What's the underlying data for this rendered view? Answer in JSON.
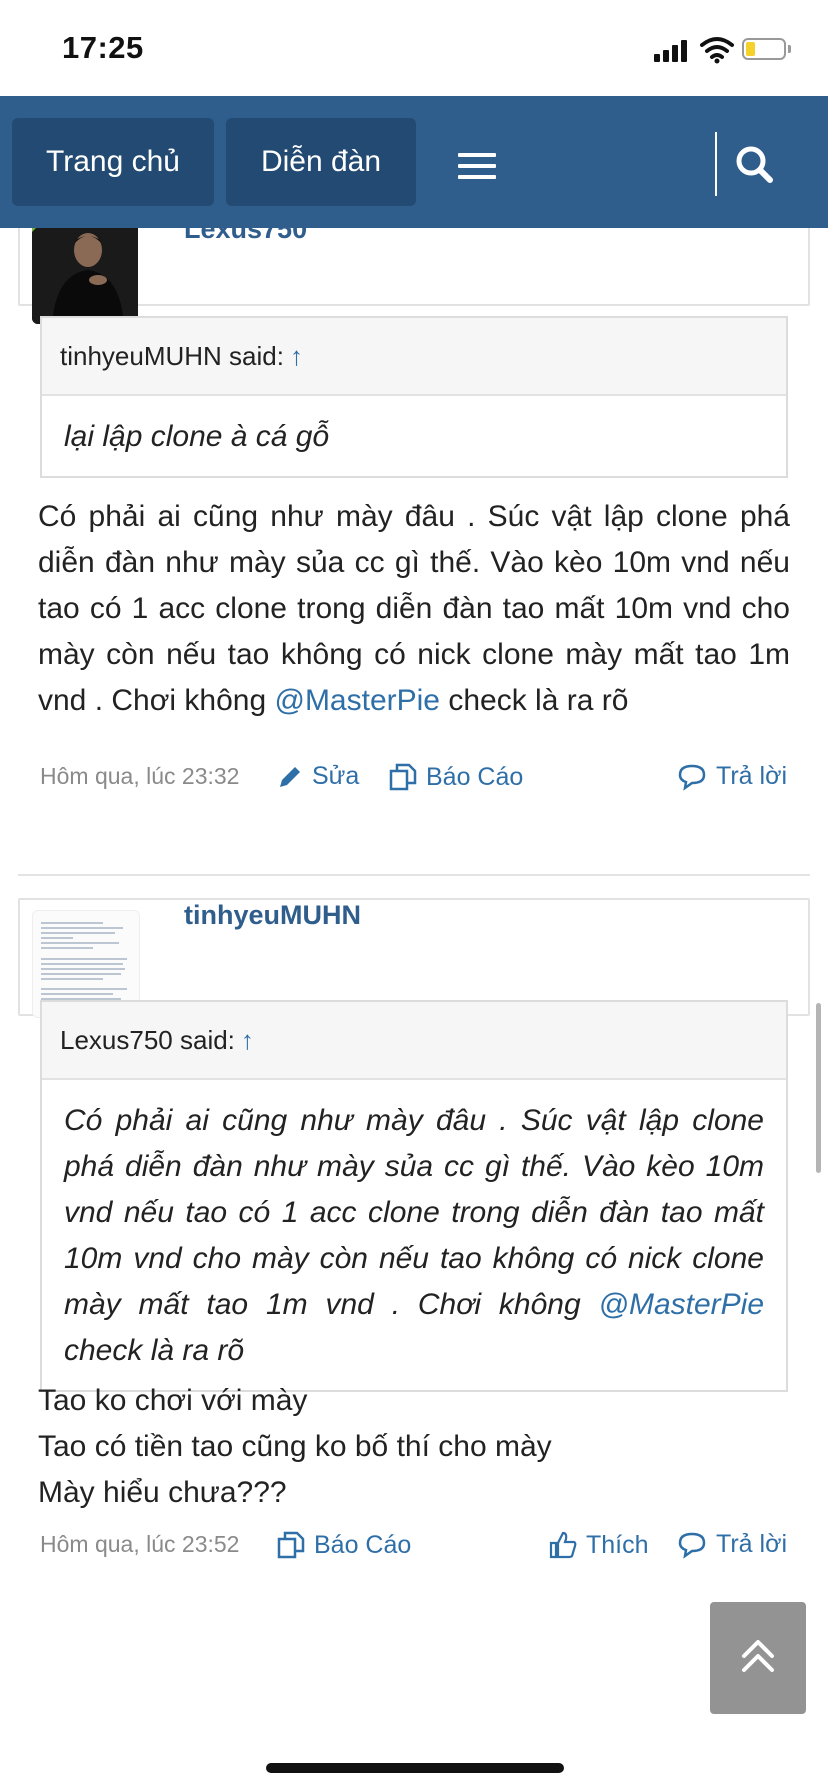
{
  "status_bar": {
    "time": "17:25",
    "battery_level": 0.25,
    "battery_color": "#f5d22b"
  },
  "nav": {
    "home_label": "Trang chủ",
    "forum_label": "Diễn đàn",
    "menu_icon": "hamburger-icon",
    "search_icon": "search-icon",
    "bar_color": "#2f5d8c"
  },
  "post1": {
    "author": "Lexus750",
    "quote": {
      "author_line": "tinhyeuMUHN said:",
      "arrow": "↑",
      "text": "lại lập clone à cá gỗ"
    },
    "body_before_mention": "Có phải ai cũng như mày đâu . Súc vật lập clone phá diễn đàn như mày sủa cc gì thế. Vào kèo 10m vnd nếu tao có 1 acc clone trong diễn đàn tao mất 10m vnd cho mày còn nếu tao không có nick clone mày mất tao 1m vnd . Chơi không ",
    "mention": "@MasterPie",
    "body_after_mention": " check là ra rõ",
    "timestamp": "Hôm qua, lúc 23:32",
    "edit_label": "Sửa",
    "report_label": "Báo Cáo",
    "reply_label": "Trả lời"
  },
  "post2": {
    "author": "tinhyeuMUHN",
    "quote": {
      "author_line": "Lexus750 said:",
      "arrow": "↑",
      "text_before_mention": "Có phải ai cũng như mày đâu . Súc vật lập clone phá diễn đàn như mày sủa cc gì thế. Vào kèo 10m vnd nếu tao có 1 acc clone trong diễn đàn tao mất 10m vnd cho mày còn nếu tao không có nick clone mày mất tao 1m vnd . Chơi không ",
      "mention": "@MasterPie",
      "text_after_mention": " check là ra rõ"
    },
    "body_lines": [
      "Tao ko chơi với mày",
      "Tao có tiền tao cũng ko bố thí cho mày",
      "Mày hiểu chưa???"
    ],
    "timestamp": "Hôm qua, lúc 23:52",
    "report_label": "Báo Cáo",
    "like_label": "Thích",
    "reply_label": "Trả lời"
  },
  "scroll_top_icon": "double-chevron-up-icon"
}
